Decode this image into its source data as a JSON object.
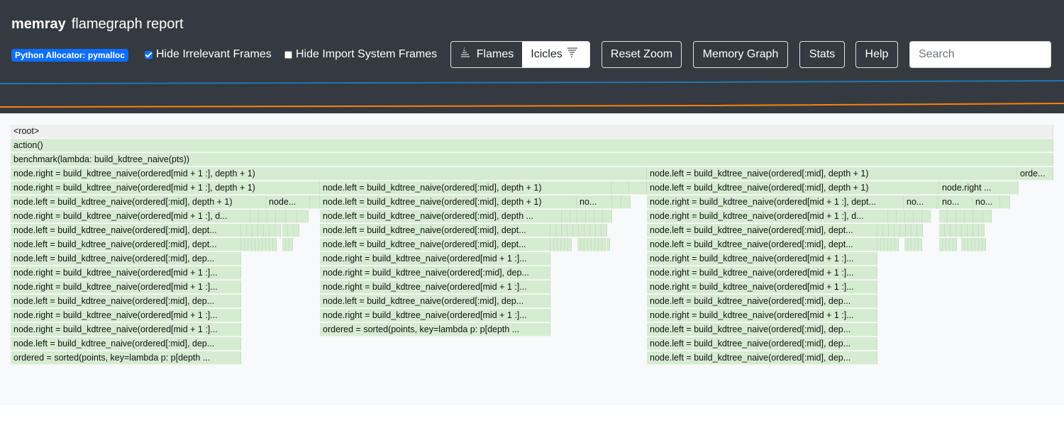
{
  "header": {
    "app_name": "memray",
    "report_title": "flamegraph report",
    "allocator_badge": "Python Allocator: pymalloc",
    "hide_irrelevant_label": "Hide Irrelevant Frames",
    "hide_irrelevant_checked": true,
    "hide_import_label": "Hide Import System Frames",
    "hide_import_checked": false,
    "view_toggle": {
      "flames_label": "Flames",
      "icicles_label": "Icicles",
      "selected": "Icicles"
    },
    "buttons": {
      "reset_zoom": "Reset Zoom",
      "memory_graph": "Memory Graph",
      "stats": "Stats",
      "help": "Help"
    },
    "search_placeholder": "Search",
    "search_value": ""
  },
  "colors": {
    "header_bg": "#343a40",
    "accent": "#0d6efd",
    "frame_green": "#d6ecd2",
    "root_frame": "#efefef",
    "memory_line_blue": "#1f77b4",
    "memory_line_orange": "#ff7f0e"
  },
  "icons": [
    "flames-icon",
    "icicles-icon",
    "checkbox-checked-icon",
    "checkbox-unchecked-icon"
  ],
  "flamegraph": {
    "rows": [
      [
        "<root>"
      ],
      [
        "action()"
      ],
      [
        "benchmark(lambda: build_kdtree_naive(pts))"
      ],
      [
        "node.right = build_kdtree_naive(ordered[mid + 1 :], depth + 1)",
        "node.left = build_kdtree_naive(ordered[:mid], depth + 1)",
        "orde..."
      ],
      [
        "node.right = build_kdtree_naive(ordered[mid + 1 :], depth + 1)",
        "node.left = build_kdtree_naive(ordered[:mid], depth + 1)",
        "node.left = build_kdtree_naive(ordered[:mid], depth + 1)",
        "node.right ..."
      ],
      [
        "node.left = build_kdtree_naive(ordered[:mid], depth + 1)",
        "node...",
        "node.left = build_kdtree_naive(ordered[:mid], depth + 1)",
        "no...",
        "node.right = build_kdtree_naive(ordered[mid + 1 :], dept...",
        "no...",
        "no...",
        "no..."
      ],
      [
        "node.right = build_kdtree_naive(ordered[mid + 1 :], d...",
        "node.left = build_kdtree_naive(ordered[:mid], depth ...",
        "node.right = build_kdtree_naive(ordered[mid + 1 :], d..."
      ],
      [
        "node.left = build_kdtree_naive(ordered[:mid], dept...",
        "node.left = build_kdtree_naive(ordered[:mid], dept...",
        "node.left = build_kdtree_naive(ordered[:mid], dept..."
      ],
      [
        "node.left = build_kdtree_naive(ordered[:mid], dept...",
        "node.left = build_kdtree_naive(ordered[:mid], dept...",
        "node.left = build_kdtree_naive(ordered[:mid], dept..."
      ],
      [
        "node.left = build_kdtree_naive(ordered[:mid], dep...",
        "node.right = build_kdtree_naive(ordered[mid + 1 :]...",
        "node.right = build_kdtree_naive(ordered[mid + 1 :]..."
      ],
      [
        "node.right = build_kdtree_naive(ordered[mid + 1 :]...",
        "node.right = build_kdtree_naive(ordered[:mid], dep...",
        "node.right = build_kdtree_naive(ordered[mid + 1 :]..."
      ],
      [
        "node.right = build_kdtree_naive(ordered[mid + 1 :]...",
        "node.right = build_kdtree_naive(ordered[mid + 1 :]...",
        "node.right = build_kdtree_naive(ordered[mid + 1 :]..."
      ],
      [
        "node.left = build_kdtree_naive(ordered[:mid], dep...",
        "node.left = build_kdtree_naive(ordered[:mid], dep...",
        "node.left = build_kdtree_naive(ordered[:mid], dep..."
      ],
      [
        "node.right = build_kdtree_naive(ordered[mid + 1 :]...",
        "node.right = build_kdtree_naive(ordered[mid + 1 :]...",
        "node.right = build_kdtree_naive(ordered[mid + 1 :]..."
      ],
      [
        "node.right = build_kdtree_naive(ordered[mid + 1 :]...",
        "ordered = sorted(points, key=lambda p: p[depth ...",
        "node.left = build_kdtree_naive(ordered[:mid], dep..."
      ],
      [
        "node.left = build_kdtree_naive(ordered[:mid], dep...",
        "node.left = build_kdtree_naive(ordered[:mid], dep..."
      ],
      [
        "ordered = sorted(points, key=lambda p: p[depth ...",
        "node.left = build_kdtree_naive(ordered[:mid], dep..."
      ]
    ]
  }
}
